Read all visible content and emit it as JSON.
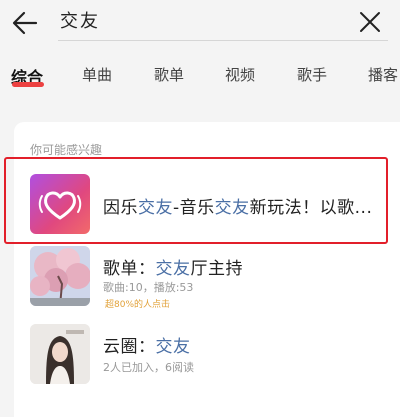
{
  "search": {
    "query": "交友"
  },
  "tabs": [
    {
      "label": "综合",
      "active": true
    },
    {
      "label": "单曲",
      "active": false
    },
    {
      "label": "歌单",
      "active": false
    },
    {
      "label": "视频",
      "active": false
    },
    {
      "label": "歌手",
      "active": false
    },
    {
      "label": "播客",
      "active": false
    }
  ],
  "colors": {
    "accent": "#ec4141",
    "keyword": "#4a6fa5",
    "highlight_border": "#e21f2a",
    "tip": "#e2a23a"
  },
  "results": {
    "section_title": "你可能感兴趣",
    "items": [
      {
        "icon": "heart-app-icon",
        "title_parts": [
          "因乐",
          "交友",
          "-音乐",
          "交友",
          "新玩法！以歌..."
        ]
      },
      {
        "icon": "cherry-blossom-cover",
        "title_parts": [
          "歌单：",
          "交友",
          "厅主持"
        ],
        "meta": "歌曲:10，播放:53",
        "note": "超80%的人点击"
      },
      {
        "icon": "portrait-cover",
        "title_parts": [
          "云圈：",
          "交友"
        ],
        "meta": "2人已加入，6阅读"
      }
    ]
  }
}
